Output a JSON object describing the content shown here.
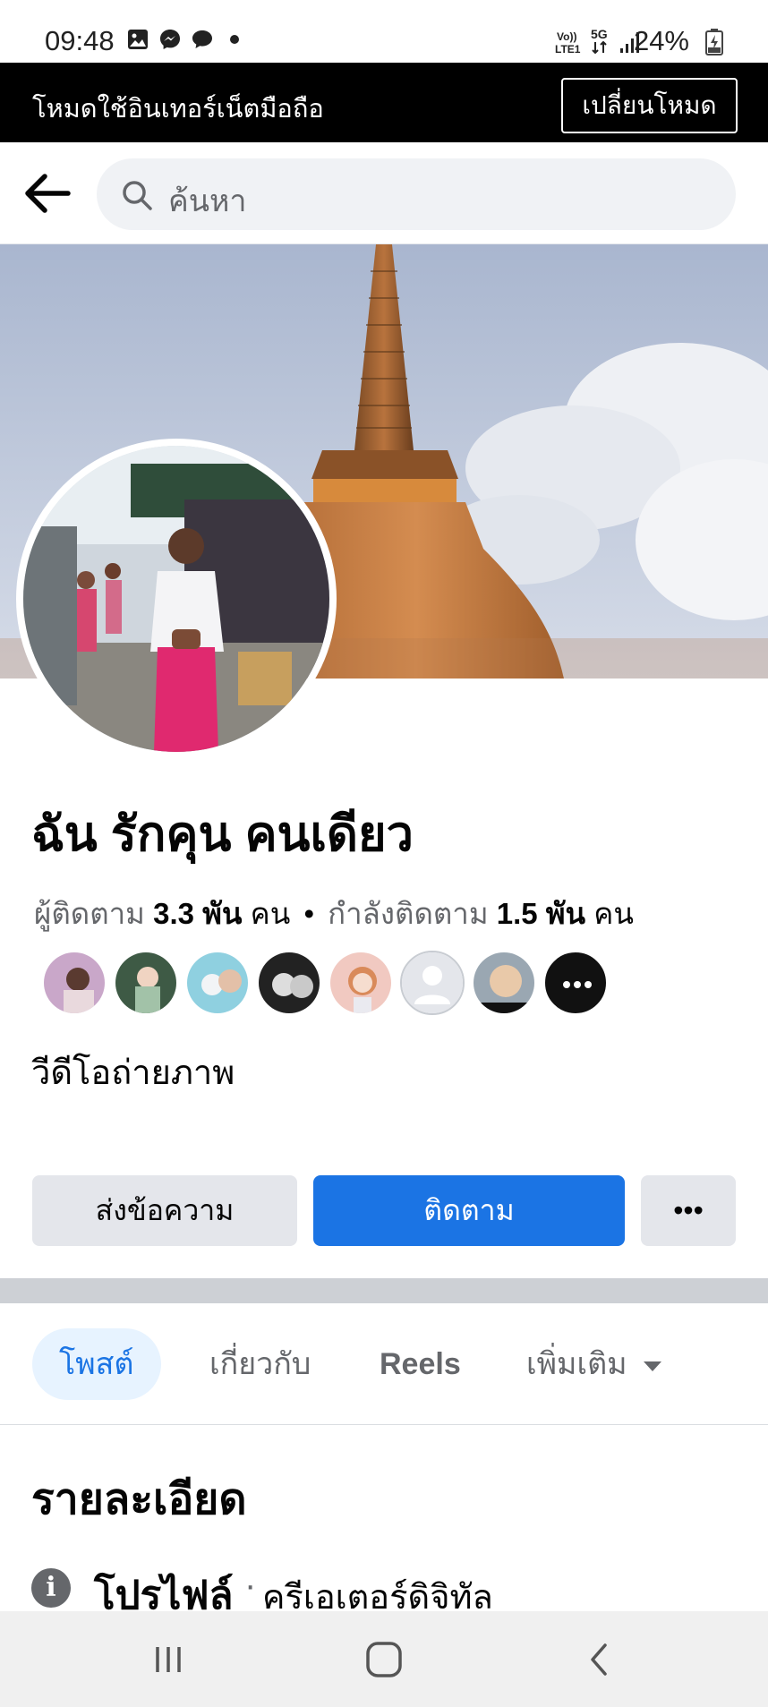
{
  "status_bar": {
    "time": "09:48",
    "left_icons": [
      "gallery-icon",
      "messenger-icon",
      "chat-bubble-icon",
      "dot-icon"
    ],
    "volte": "Vo))",
    "lte": "LTE1",
    "network": "5G",
    "battery": "24%"
  },
  "banner": {
    "text": "โหมดใช้อินเทอร์เน็ตมือถือ",
    "button": "เปลี่ยนโหมด"
  },
  "search": {
    "placeholder": "ค้นหา"
  },
  "profile": {
    "name": "ฉัน รักคุน คนเดียว",
    "followers_label": "ผู้ติดตาม",
    "followers_count": "3.3 พัน",
    "followers_unit": "คน",
    "dot": "•",
    "following_label": "กำลังติดตาม",
    "following_count": "1.5 พัน",
    "following_unit": "คน",
    "category": "วีดีโอถ่ายภาพ"
  },
  "actions": {
    "message": "ส่งข้อความ",
    "follow": "ติดตาม",
    "more": "•••"
  },
  "tabs": {
    "posts": "โพสต์",
    "about": "เกี่ยวกับ",
    "reels": "Reels",
    "more": "เพิ่มเติม"
  },
  "details": {
    "title": "รายละเอียด",
    "profile_label": "โปรไฟล์",
    "separator": "·",
    "profile_type": "ครีเอเตอร์ดิจิทัล"
  },
  "colors": {
    "accent": "#1b74e4",
    "banner_bg": "#000000",
    "button_gray": "#e4e6eb"
  }
}
